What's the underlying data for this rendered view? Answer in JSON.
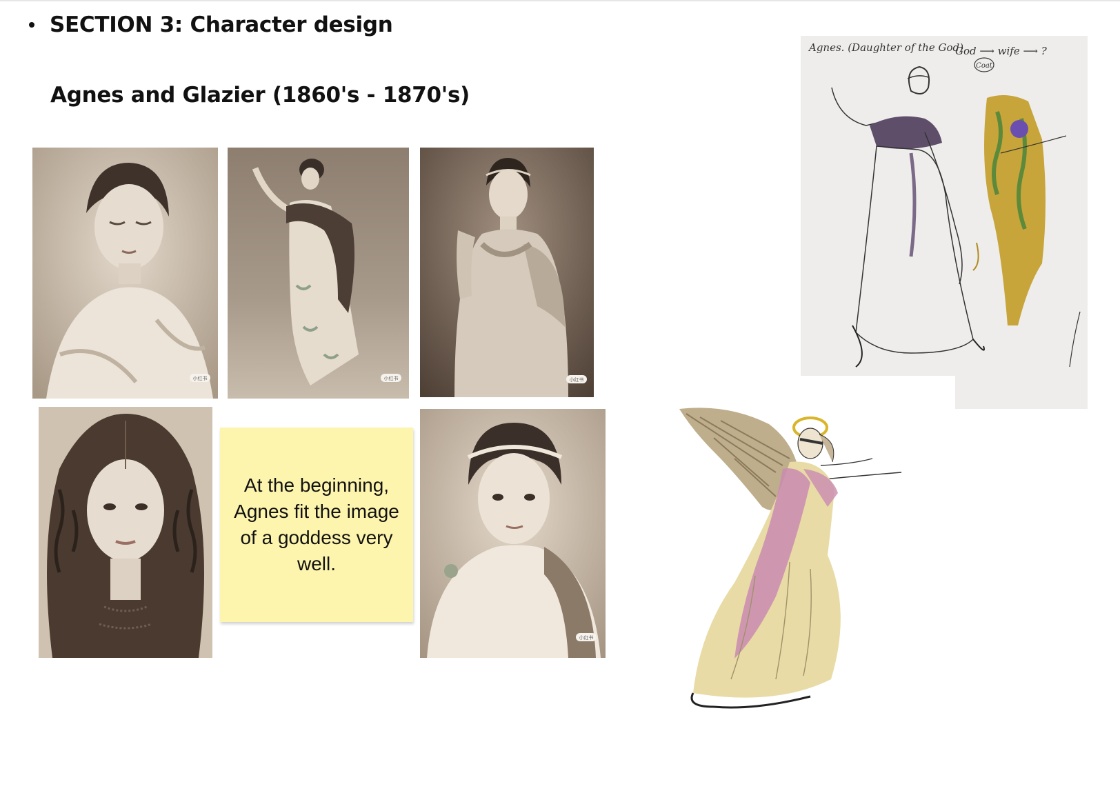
{
  "page": {
    "section_heading": "SECTION 3: Character design",
    "subheading": "Agnes and Glazier (1860's - 1870's)"
  },
  "photos": [
    {
      "name": "photo-portrait-looking-down",
      "stamp": "小红书"
    },
    {
      "name": "photo-full-length-gown",
      "stamp": "小红书"
    },
    {
      "name": "photo-headband-draped-dress",
      "stamp": "小红书"
    },
    {
      "name": "photo-long-wavy-hair"
    },
    {
      "name": "photo-headband-closeup",
      "stamp": "小红书"
    }
  ],
  "sticky_note": {
    "text": "At the beginning, Agnes fit the image of a goddess very well."
  },
  "sketch": {
    "caption": "Agnes. (Daughter of the God).",
    "flow": "God ⟶ wife ⟶ ?",
    "circled": "Coat"
  },
  "colors": {
    "sticky": "#fdf5ad",
    "sepia_light": "#d9cdbd",
    "sepia_dark": "#6b5a4a"
  }
}
